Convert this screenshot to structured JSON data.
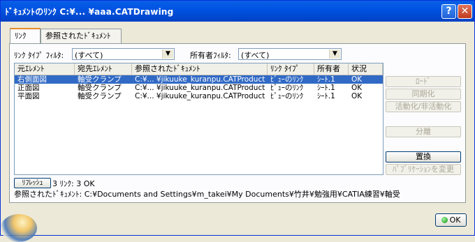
{
  "window": {
    "title": "ﾄﾞｷｭﾒﾝﾄのﾘﾝｸ C:¥... ¥aaa.CATDrawing"
  },
  "title_buttons": {
    "help": "?",
    "close": "✕"
  },
  "tabs": [
    {
      "label": "ﾘﾝｸ"
    },
    {
      "label": "参照されたﾄﾞｷｭﾒﾝﾄ"
    }
  ],
  "filters": {
    "link_type_label": "ﾘﾝｸ ﾀｲﾌﾟ ﾌｨﾙﾀ:",
    "link_type_value": "(すべて)",
    "owner_label": "所有者ﾌｨﾙﾀ:",
    "owner_value": "(すべて)"
  },
  "table": {
    "columns": [
      "元ｴﾚﾒﾝﾄ",
      "宛先ｴﾚﾒﾝﾄ",
      "参照されたﾄﾞｷｭﾒﾝﾄ",
      "ﾘﾝｸ ﾀｲﾌﾟ",
      "所有者",
      "状況"
    ],
    "rows": [
      [
        "右側面図",
        "軸受クランプ",
        "C:¥... ¥jikuuke_kuranpu.CATProduct",
        "ﾋﾞｭｰのﾘﾝｸ",
        "ｼｰﾄ.1",
        "OK"
      ],
      [
        "正面図",
        "軸受クランプ",
        "C:¥... ¥jikuuke_kuranpu.CATProduct",
        "ﾋﾞｭｰのﾘﾝｸ",
        "ｼｰﾄ.1",
        "OK"
      ],
      [
        "平面図",
        "軸受クランプ",
        "C:¥... ¥jikuuke_kuranpu.CATProduct",
        "ﾋﾞｭｰのﾘﾝｸ",
        "ｼｰﾄ.1",
        "OK"
      ]
    ],
    "selected_row": 0
  },
  "side_buttons": {
    "load": "ﾛｰﾄﾞ",
    "sync": "同期化",
    "activate": "活動化/非活動化",
    "isolate": "分離",
    "replace": "置換",
    "change_publication": "ﾊﾟﾌﾞﾘｹｰｼｮﾝを変更"
  },
  "refresh": {
    "label": "ﾘﾌﾚｯｼｭ",
    "status": "3 ﾘﾝｸ: 3 OK"
  },
  "referenced_path": "参照されたﾄﾞｷｭﾒﾝﾄ: C:¥Documents and Settings¥m_takei¥My Documents¥竹井¥勉強用¥CATIA練習¥軸受",
  "ok_label": "OK"
}
